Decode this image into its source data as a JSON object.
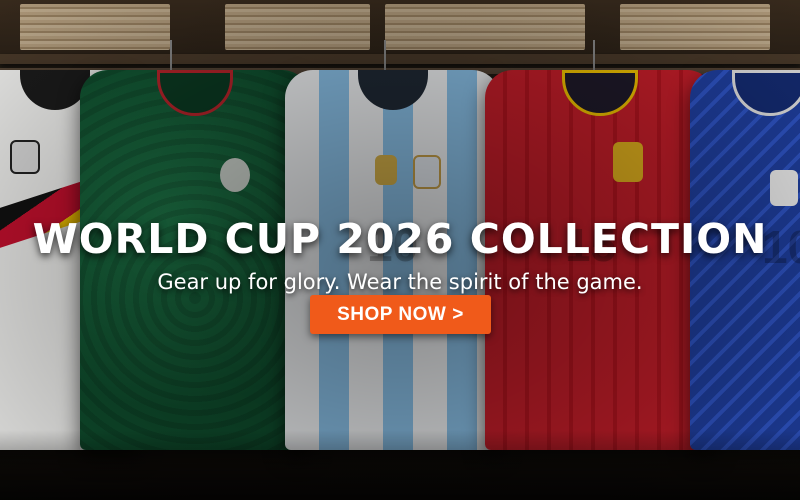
{
  "banner": {
    "headline": "WORLD CUP 2026 COLLECTION",
    "subheadline": "Gear up for glory. Wear the spirit of the game.",
    "cta_label": "SHOP NOW",
    "cta_chevron": ">",
    "accent_color": "#f05a1a"
  },
  "jerseys": [
    {
      "team": "germany",
      "number": "",
      "colors": [
        "#f2f2f0",
        "#111111",
        "#c8102e",
        "#f4c300"
      ]
    },
    {
      "team": "mexico",
      "number": "",
      "colors": [
        "#0f4f2e",
        "#b8242b"
      ]
    },
    {
      "team": "argentina",
      "number": "10",
      "colors": [
        "#f4f6f8",
        "#8cc4ec"
      ]
    },
    {
      "team": "spain",
      "number": "15",
      "colors": [
        "#c81e2a",
        "#f2c300"
      ]
    },
    {
      "team": "japan",
      "number": "10",
      "colors": [
        "#1f3fa0",
        "#e0e0e0"
      ]
    }
  ]
}
